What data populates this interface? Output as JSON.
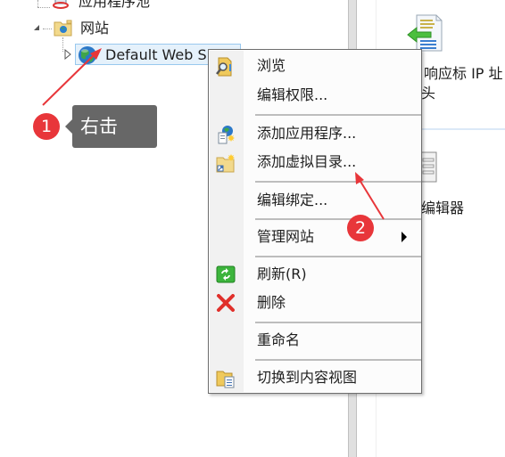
{
  "tree": {
    "items": [
      {
        "label": "应用程序池",
        "icon": "app-pool-icon",
        "expander": "none"
      },
      {
        "label": "网站",
        "icon": "sites-folder-icon",
        "expander": "expanded"
      },
      {
        "label": "Default Web Site",
        "icon": "globe-icon",
        "expander": "collapsed",
        "selected": true
      }
    ]
  },
  "context_menu": {
    "items": [
      {
        "label": "浏览",
        "icon": "explore-folder-icon"
      },
      {
        "label": "编辑权限...",
        "icon": ""
      },
      {
        "label": "添加应用程序...",
        "icon": "add-application-icon"
      },
      {
        "label": "添加虚拟目录...",
        "icon": "add-virtual-directory-icon"
      },
      {
        "label": "编辑绑定...",
        "icon": ""
      },
      {
        "label": "管理网站",
        "icon": "",
        "submenu": true
      },
      {
        "label": "刷新(R)",
        "icon": "refresh-icon"
      },
      {
        "label": "删除",
        "icon": "delete-icon"
      },
      {
        "label": "重命名",
        "icon": ""
      },
      {
        "label": "切换到内容视图",
        "icon": "content-view-icon"
      }
    ]
  },
  "right_pane": {
    "feature1_line1": "响应标  IP 址",
    "feature1_line2": "头",
    "feature2_label": "编辑器"
  },
  "annotations": {
    "step1_number": "1",
    "step1_tooltip": "右击",
    "step2_number": "2",
    "arrow_color": "#e8363a"
  }
}
